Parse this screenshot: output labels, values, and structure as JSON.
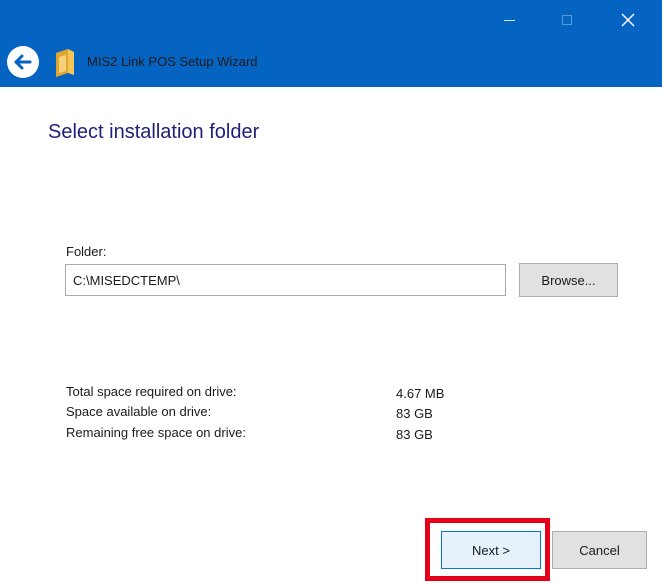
{
  "window": {
    "title": "MIS2 Link POS Setup Wizard",
    "controls": {
      "minimize": "—",
      "maximize": "☐",
      "close": "✕"
    },
    "accent_color": "#0563c1"
  },
  "page": {
    "heading": "Select installation folder",
    "folder_label": "Folder:",
    "folder_value": "C:\\MISEDCTEMP\\",
    "browse_label": "Browse..."
  },
  "space_info": {
    "rows": [
      {
        "label": "Total space required on drive:",
        "value": "4.67 MB"
      },
      {
        "label": "Space available on drive:",
        "value": "83 GB"
      },
      {
        "label": "Remaining free space on drive:",
        "value": "83 GB"
      }
    ]
  },
  "footer": {
    "next_label": "Next >",
    "cancel_label": "Cancel",
    "highlight_color": "#e3001b"
  },
  "icons": [
    "back-arrow-icon",
    "folder-icon",
    "minimize-icon",
    "maximize-icon",
    "close-icon"
  ]
}
